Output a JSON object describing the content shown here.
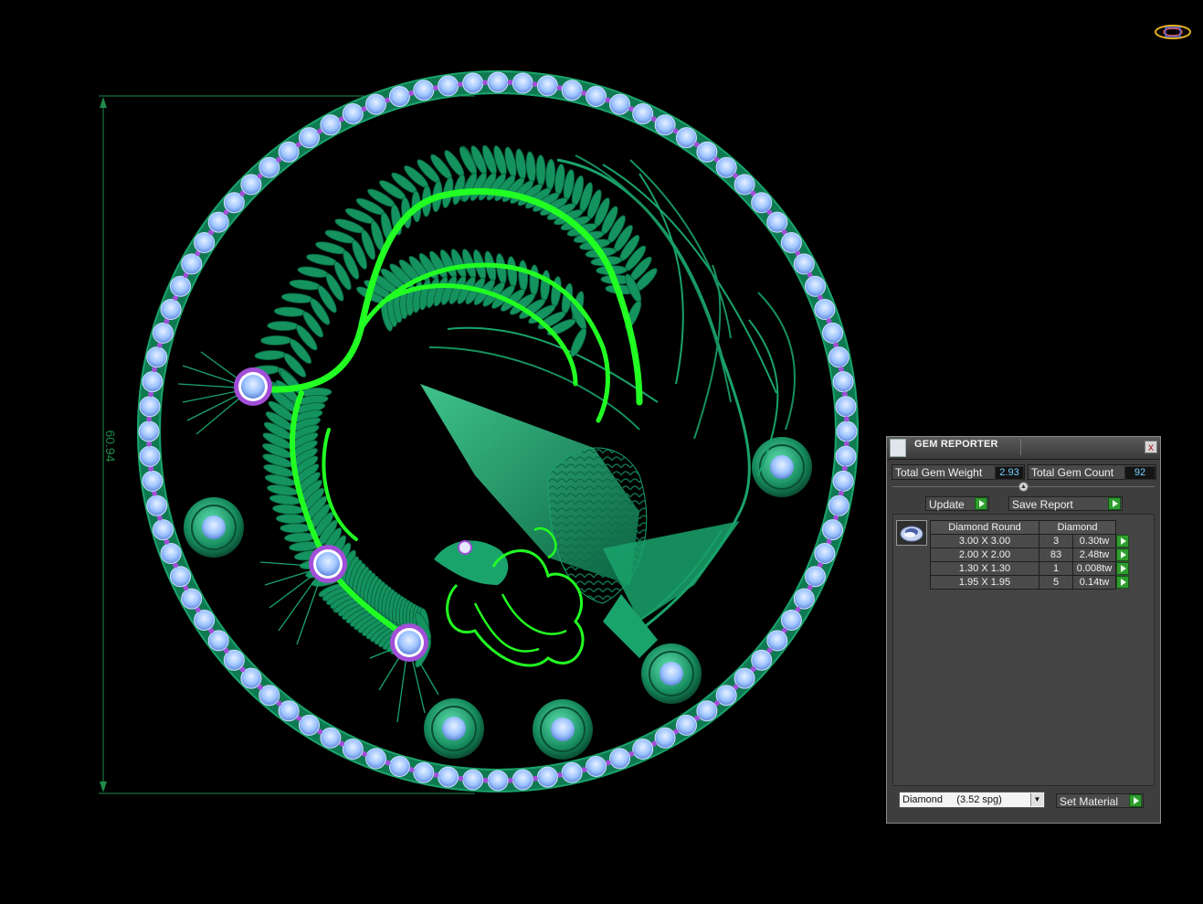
{
  "dimension_label": "60.94",
  "gem_reporter": {
    "title": "GEM REPORTER",
    "close_label": "x",
    "total_gem_weight_label": "Total Gem Weight",
    "total_gem_weight_value": "2.93",
    "total_gem_count_label": "Total Gem Count",
    "total_gem_count_value": "92",
    "update_label": "Update",
    "save_report_label": "Save Report",
    "set_material_label": "Set Material",
    "material_selected": "Diamond     (3.52 spg)",
    "table": {
      "headers": [
        "Diamond Round",
        "Diamond"
      ],
      "rows": [
        {
          "size": "3.00 X 3.00",
          "count": "3",
          "weight": "0.30tw"
        },
        {
          "size": "2.00 X 2.00",
          "count": "83",
          "weight": "2.48tw"
        },
        {
          "size": "1.30 X 1.30",
          "count": "1",
          "weight": "0.008tw"
        },
        {
          "size": "1.95 X 1.95",
          "count": "5",
          "weight": "0.14tw"
        }
      ]
    }
  },
  "colors": {
    "background": "#000000",
    "model_green": "#1aa36b",
    "highlight_green": "#22ff22",
    "gem_blue": "#9ec4ff",
    "accent_purple": "#a24fd8",
    "dimension_line": "#1f8a4a",
    "value_text": "#76d0ff"
  }
}
